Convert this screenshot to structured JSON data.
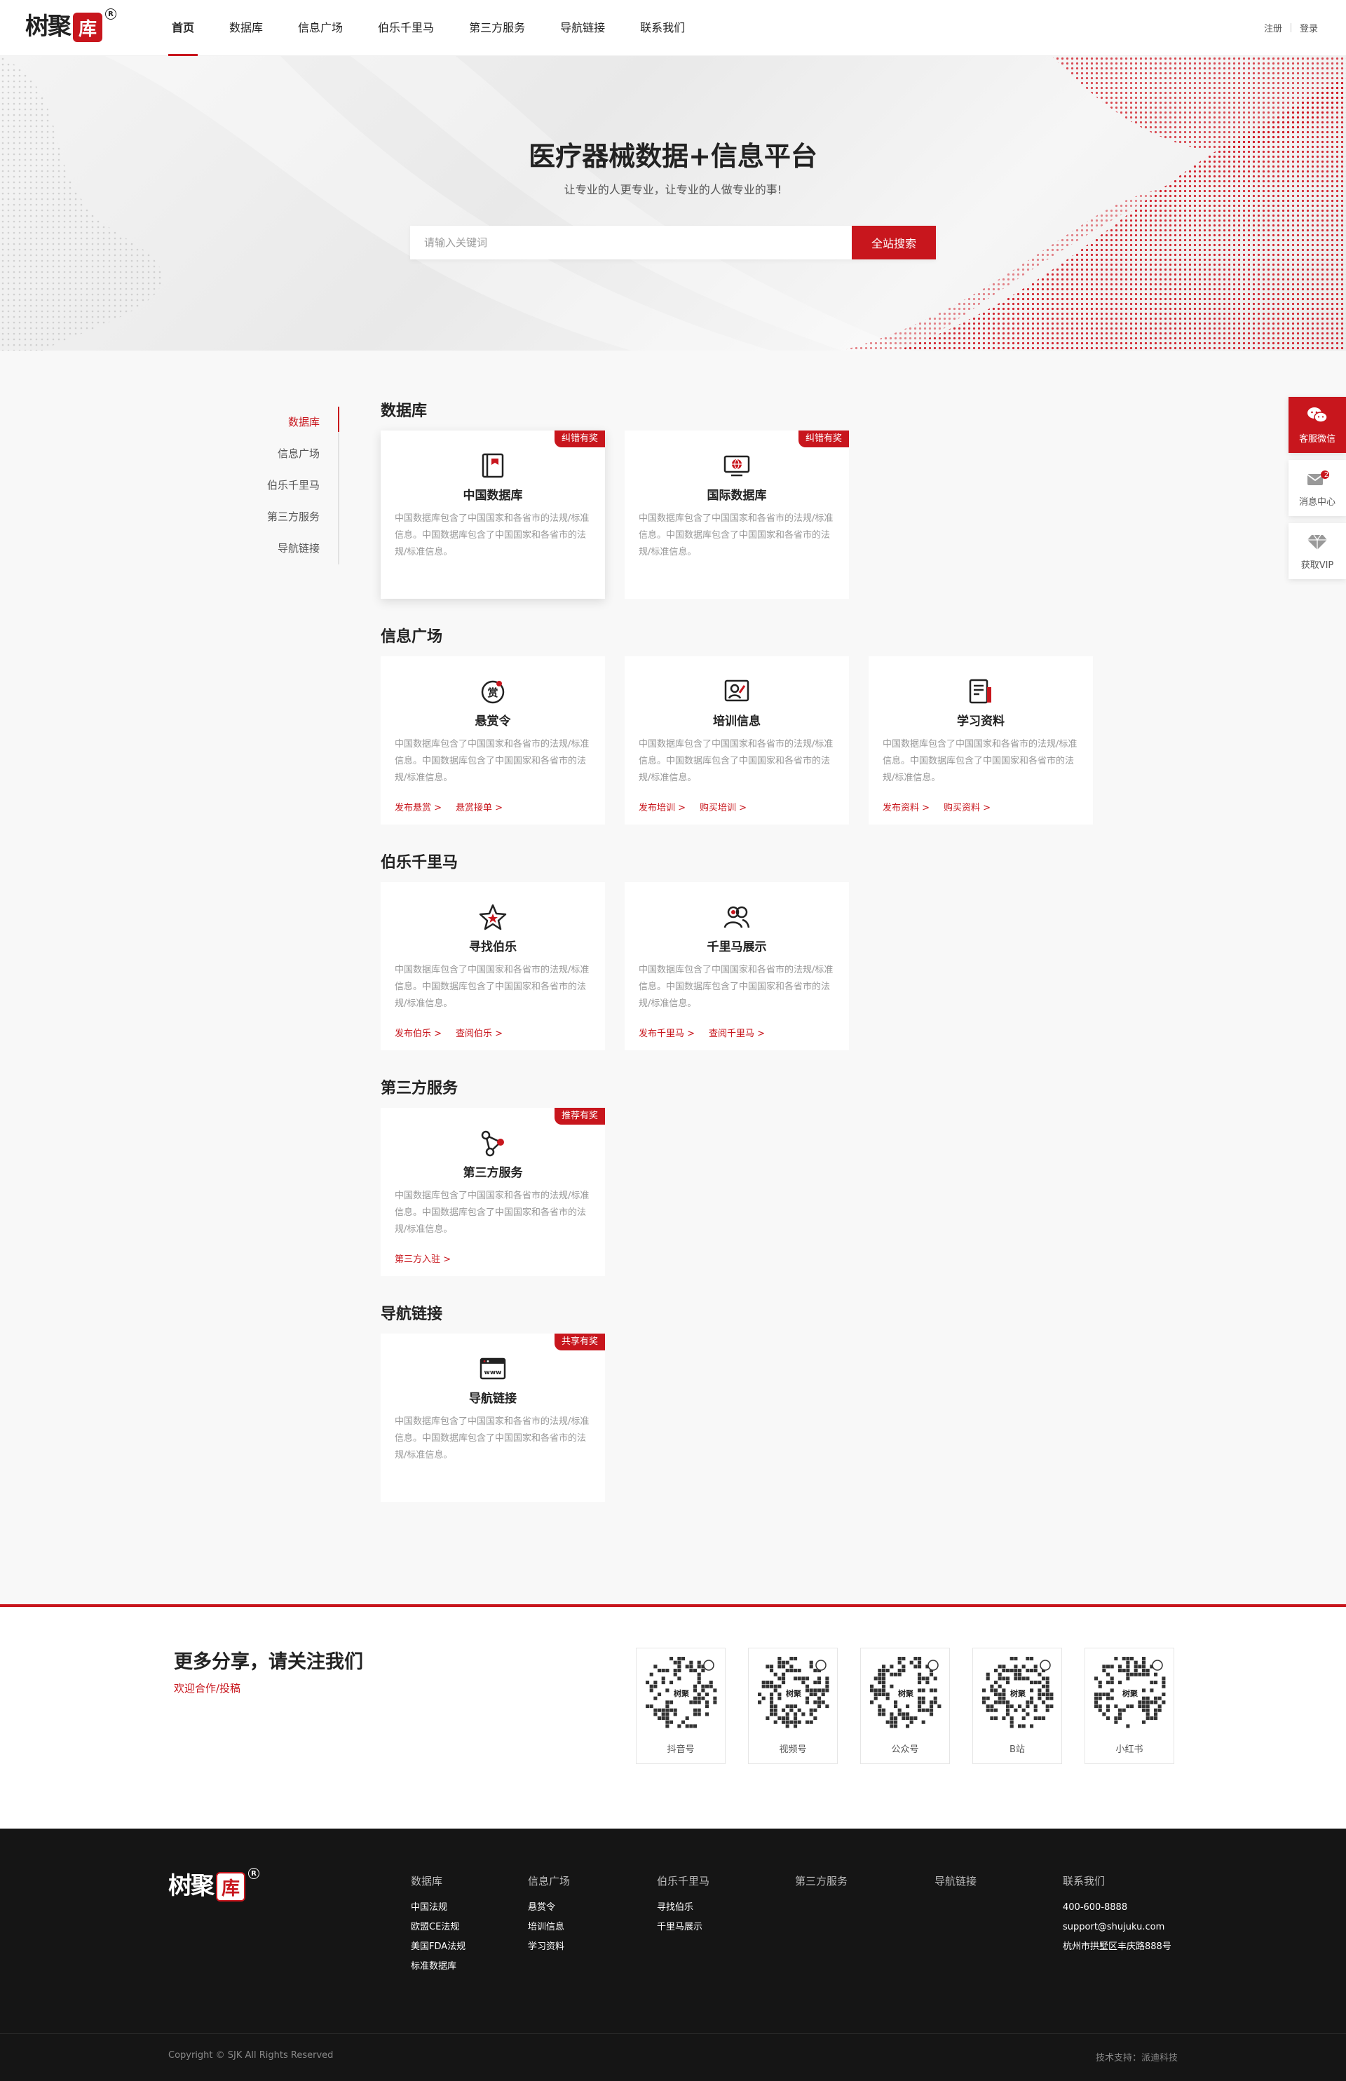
{
  "brand": {
    "logo_text": "树聚",
    "logo_seal": "库",
    "logo_reg": "R"
  },
  "header": {
    "nav": [
      "首页",
      "数据库",
      "信息广场",
      "伯乐千里马",
      "第三方服务",
      "导航链接",
      "联系我们"
    ],
    "register": "注册",
    "login": "登录"
  },
  "hero": {
    "title": "医疗器械数据+信息平台",
    "subtitle": "让专业的人更专业，让专业的人做专业的事!",
    "search_placeholder": "请输入关键词",
    "search_button": "全站搜索"
  },
  "sidebar": [
    "数据库",
    "信息广场",
    "伯乐千里马",
    "第三方服务",
    "导航链接"
  ],
  "sections": {
    "db": {
      "title": "数据库",
      "cards": [
        {
          "title": "中国数据库",
          "badge": "纠错有奖",
          "desc": "中国数据库包含了中国国家和各省市的法规/标准信息。中国数据库包含了中国国家和各省市的法规/标准信息。",
          "icon": "book-icon"
        },
        {
          "title": "国际数据库",
          "badge": "纠错有奖",
          "desc": "中国数据库包含了中国国家和各省市的法规/标准信息。中国数据库包含了中国国家和各省市的法规/标准信息。",
          "icon": "globe-monitor-icon"
        }
      ]
    },
    "info": {
      "title": "信息广场",
      "cards": [
        {
          "title": "悬赏令",
          "desc": "中国数据库包含了中国国家和各省市的法规/标准信息。中国数据库包含了中国国家和各省市的法规/标准信息。",
          "links": [
            "发布悬赏 >",
            "悬赏接单 >"
          ],
          "icon": "reward-icon"
        },
        {
          "title": "培训信息",
          "desc": "中国数据库包含了中国国家和各省市的法规/标准信息。中国数据库包含了中国国家和各省市的法规/标准信息。",
          "links": [
            "发布培训 >",
            "购买培训 >"
          ],
          "icon": "training-icon"
        },
        {
          "title": "学习资料",
          "desc": "中国数据库包含了中国国家和各省市的法规/标准信息。中国数据库包含了中国国家和各省市的法规/标准信息。",
          "links": [
            "发布资料 >",
            "购买资料 >"
          ],
          "icon": "document-icon"
        }
      ]
    },
    "talent": {
      "title": "伯乐千里马",
      "cards": [
        {
          "title": "寻找伯乐",
          "desc": "中国数据库包含了中国国家和各省市的法规/标准信息。中国数据库包含了中国国家和各省市的法规/标准信息。",
          "links": [
            "发布伯乐 >",
            "查阅伯乐 >"
          ],
          "icon": "star-icon"
        },
        {
          "title": "千里马展示",
          "desc": "中国数据库包含了中国国家和各省市的法规/标准信息。中国数据库包含了中国国家和各省市的法规/标准信息。",
          "links": [
            "发布千里马 >",
            "查阅千里马 >"
          ],
          "icon": "users-icon"
        }
      ]
    },
    "third": {
      "title": "第三方服务",
      "cards": [
        {
          "title": "第三方服务",
          "badge": "推荐有奖",
          "desc": "中国数据库包含了中国国家和各省市的法规/标准信息。中国数据库包含了中国国家和各省市的法规/标准信息。",
          "links": [
            "第三方入驻 >"
          ],
          "icon": "share-nodes-icon"
        }
      ]
    },
    "nav": {
      "title": "导航链接",
      "cards": [
        {
          "title": "导航链接",
          "badge": "共享有奖",
          "desc": "中国数据库包含了中国国家和各省市的法规/标准信息。中国数据库包含了中国国家和各省市的法规/标准信息。",
          "icon": "www-browser-icon"
        }
      ]
    }
  },
  "follow": {
    "title": "更多分享，请关注我们",
    "coop": "欢迎合作/投稿",
    "qrs": [
      "抖音号",
      "视频号",
      "公众号",
      "B站",
      "小红书"
    ]
  },
  "footer": {
    "cols": [
      {
        "h": "数据库",
        "items": [
          "中国法规",
          "欧盟CE法规",
          "美国FDA法规",
          "标准数据库"
        ]
      },
      {
        "h": "信息广场",
        "items": [
          "悬赏令",
          "培训信息",
          "学习资料"
        ]
      },
      {
        "h": "伯乐千里马",
        "items": [
          "寻找伯乐",
          "千里马展示"
        ]
      },
      {
        "h": "第三方服务",
        "items": []
      },
      {
        "h": "导航链接",
        "items": []
      },
      {
        "h": "联系我们",
        "items": [
          "400-600-8888",
          "support@shujuku.com",
          "杭州市拱墅区丰庆路888号"
        ]
      }
    ],
    "copyright": "Copyright © SJK All Rights Reserved",
    "tech": "技术支持：派迪科技"
  },
  "float": {
    "wechat": "客服微信",
    "msg": "消息中心",
    "msg_count": "2",
    "vip": "获取VIP"
  },
  "colors": {
    "accent": "#c8161d",
    "footer_bg": "#151515"
  }
}
